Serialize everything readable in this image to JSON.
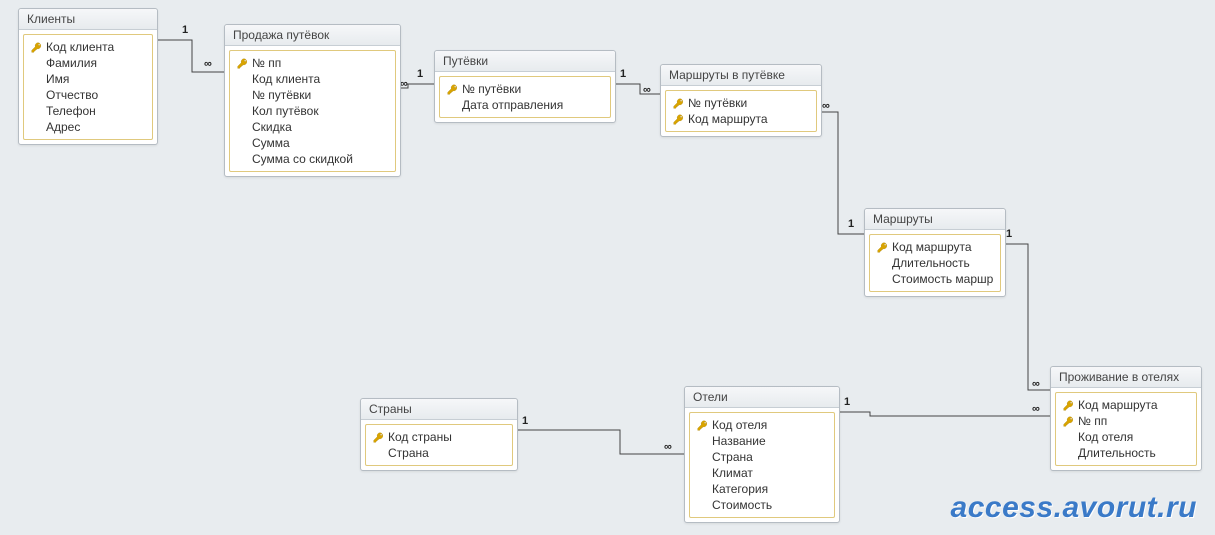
{
  "entities": {
    "clients": {
      "title": "Клиенты",
      "fields": [
        {
          "name": "Код клиента",
          "pk": true
        },
        {
          "name": "Фамилия",
          "pk": false
        },
        {
          "name": "Имя",
          "pk": false
        },
        {
          "name": "Отчество",
          "pk": false
        },
        {
          "name": "Телефон",
          "pk": false
        },
        {
          "name": "Адрес",
          "pk": false
        }
      ]
    },
    "sales": {
      "title": "Продажа путёвок",
      "fields": [
        {
          "name": "№ пп",
          "pk": true
        },
        {
          "name": "Код клиента",
          "pk": false
        },
        {
          "name": "№ путёвки",
          "pk": false
        },
        {
          "name": "Кол путёвок",
          "pk": false
        },
        {
          "name": "Скидка",
          "pk": false
        },
        {
          "name": "Сумма",
          "pk": false
        },
        {
          "name": "Сумма со скидкой",
          "pk": false
        }
      ]
    },
    "trips": {
      "title": "Путёвки",
      "fields": [
        {
          "name": "№ путёвки",
          "pk": true
        },
        {
          "name": "Дата отправления",
          "pk": false
        }
      ]
    },
    "routes_in_trip": {
      "title": "Маршруты в путёвке",
      "fields": [
        {
          "name": "№ путёвки",
          "pk": true
        },
        {
          "name": "Код маршрута",
          "pk": true
        }
      ]
    },
    "routes": {
      "title": "Маршруты",
      "fields": [
        {
          "name": "Код маршрута",
          "pk": true
        },
        {
          "name": "Длительность",
          "pk": false
        },
        {
          "name": "Стоимость маршр",
          "pk": false
        }
      ]
    },
    "hotel_stays": {
      "title": "Проживание в отелях",
      "fields": [
        {
          "name": "Код маршрута",
          "pk": true
        },
        {
          "name": "№ пп",
          "pk": true
        },
        {
          "name": "Код отеля",
          "pk": false
        },
        {
          "name": "Длительность",
          "pk": false
        }
      ]
    },
    "countries": {
      "title": "Страны",
      "fields": [
        {
          "name": "Код страны",
          "pk": true
        },
        {
          "name": "Страна",
          "pk": false
        }
      ]
    },
    "hotels": {
      "title": "Отели",
      "fields": [
        {
          "name": "Код отеля",
          "pk": true
        },
        {
          "name": "Название",
          "pk": false
        },
        {
          "name": "Страна",
          "pk": false
        },
        {
          "name": "Климат",
          "pk": false
        },
        {
          "name": "Категория",
          "pk": false
        },
        {
          "name": "Стоимость",
          "pk": false
        }
      ]
    }
  },
  "relationships": [
    {
      "from": "clients",
      "to": "sales",
      "from_card": "1",
      "to_card": "∞"
    },
    {
      "from": "trips",
      "to": "sales",
      "from_card": "1",
      "to_card": "∞"
    },
    {
      "from": "trips",
      "to": "routes_in_trip",
      "from_card": "1",
      "to_card": "∞"
    },
    {
      "from": "routes",
      "to": "routes_in_trip",
      "from_card": "1",
      "to_card": "∞"
    },
    {
      "from": "routes",
      "to": "hotel_stays",
      "from_card": "1",
      "to_card": "∞"
    },
    {
      "from": "hotels",
      "to": "hotel_stays",
      "from_card": "1",
      "to_card": "∞"
    },
    {
      "from": "countries",
      "to": "hotels",
      "from_card": "1",
      "to_card": "∞"
    }
  ],
  "watermark": "access.avorut.ru"
}
